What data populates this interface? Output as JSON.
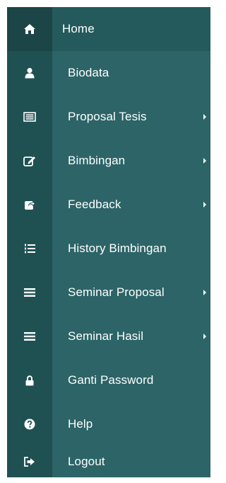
{
  "menu": {
    "items": [
      {
        "key": "home",
        "label": "Home",
        "icon": "home-icon",
        "has_submenu": false
      },
      {
        "key": "biodata",
        "label": "Biodata",
        "icon": "user-icon",
        "has_submenu": false
      },
      {
        "key": "proposal-tesis",
        "label": "Proposal Tesis",
        "icon": "list-box-icon",
        "has_submenu": true
      },
      {
        "key": "bimbingan",
        "label": "Bimbingan",
        "icon": "edit-icon",
        "has_submenu": true
      },
      {
        "key": "feedback",
        "label": "Feedback",
        "icon": "share-icon",
        "has_submenu": true
      },
      {
        "key": "history-bimbingan",
        "label": "History Bimbingan",
        "icon": "ordered-list-icon",
        "has_submenu": false
      },
      {
        "key": "seminar-proposal",
        "label": "Seminar Proposal",
        "icon": "hamburger-icon",
        "has_submenu": true
      },
      {
        "key": "seminar-hasil",
        "label": "Seminar Hasil",
        "icon": "hamburger-icon",
        "has_submenu": true
      },
      {
        "key": "ganti-password",
        "label": "Ganti Password",
        "icon": "lock-icon",
        "has_submenu": false
      },
      {
        "key": "help",
        "label": "Help",
        "icon": "question-icon",
        "has_submenu": false
      },
      {
        "key": "logout",
        "label": "Logout",
        "icon": "sign-out-icon",
        "has_submenu": false
      }
    ]
  },
  "colors": {
    "sidebar_bg": "#2c6467",
    "icon_column_bg": "#1f5153",
    "text": "#ffffff"
  }
}
